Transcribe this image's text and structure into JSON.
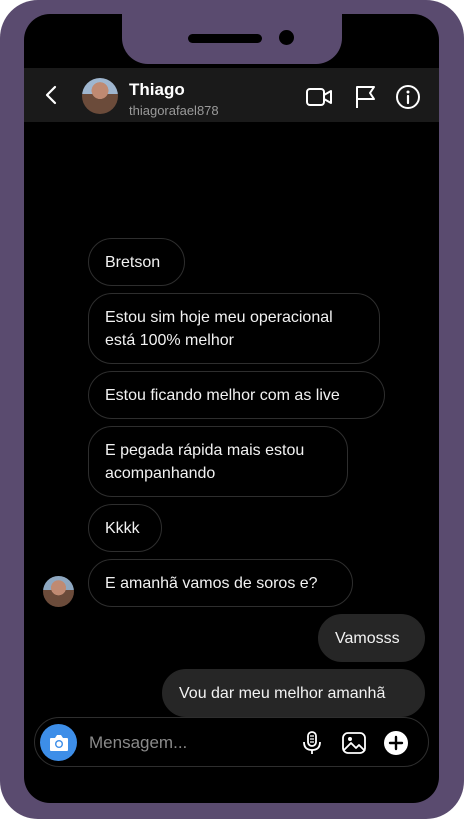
{
  "header": {
    "name": "Thiago",
    "username": "thiagorafael878",
    "icons": [
      "back-chevron-icon",
      "video-call-icon",
      "flag-icon",
      "info-icon"
    ]
  },
  "messages": [
    {
      "text": "Bretson",
      "direction": "incoming"
    },
    {
      "text": "Estou sim hoje meu operacional está 100% melhor",
      "direction": "incoming"
    },
    {
      "text": "Estou ficando melhor com as live",
      "direction": "incoming"
    },
    {
      "text": "E pegada rápida mais estou acompanhando",
      "direction": "incoming"
    },
    {
      "text": "Kkkk",
      "direction": "incoming"
    },
    {
      "text": "E amanhã vamos de soros e?",
      "direction": "incoming"
    },
    {
      "text": "Vamosss",
      "direction": "outgoing"
    },
    {
      "text": "Vou dar meu melhor amanhã",
      "direction": "outgoing"
    }
  ],
  "composer": {
    "placeholder": "Mensagem...",
    "value": "",
    "icons": [
      "camera-icon",
      "microphone-icon",
      "gallery-icon",
      "plus-icon"
    ]
  },
  "colors": {
    "frame": "#5a4b6f",
    "background": "#000000",
    "header": "#1a1a1a",
    "outgoing_bubble": "#262626",
    "camera_button": "#3d8ee8"
  }
}
